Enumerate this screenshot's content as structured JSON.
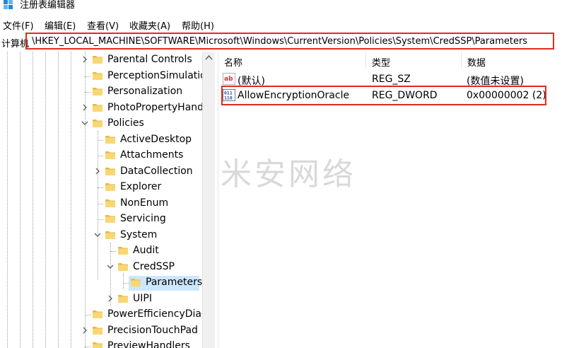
{
  "window": {
    "title": "注册表编辑器"
  },
  "menu": [
    {
      "label": "文件(F)"
    },
    {
      "label": "编辑(E)"
    },
    {
      "label": "查看(V)"
    },
    {
      "label": "收藏夹(A)"
    },
    {
      "label": "帮助(H)"
    }
  ],
  "address": {
    "prefix": "计算机",
    "path": "\\HKEY_LOCAL_MACHINE\\SOFTWARE\\Microsoft\\Windows\\CurrentVersion\\Policies\\System\\CredSSP\\Parameters"
  },
  "tree": {
    "nodes": [
      {
        "label": "Parental Controls",
        "expander": "collapsed"
      },
      {
        "label": "PerceptionSimulatio",
        "expander": "none"
      },
      {
        "label": "Personalization",
        "expander": "none"
      },
      {
        "label": "PhotoPropertyHand",
        "expander": "collapsed"
      },
      {
        "label": "Policies",
        "expander": "expanded"
      },
      {
        "label": "ActiveDesktop",
        "expander": "none"
      },
      {
        "label": "Attachments",
        "expander": "none"
      },
      {
        "label": "DataCollection",
        "expander": "collapsed"
      },
      {
        "label": "Explorer",
        "expander": "none"
      },
      {
        "label": "NonEnum",
        "expander": "none"
      },
      {
        "label": "Servicing",
        "expander": "none"
      },
      {
        "label": "System",
        "expander": "expanded"
      },
      {
        "label": "Audit",
        "expander": "none"
      },
      {
        "label": "CredSSP",
        "expander": "expanded"
      },
      {
        "label": "Parameters",
        "expander": "none",
        "selected": true
      },
      {
        "label": "UIPI",
        "expander": "collapsed"
      },
      {
        "label": "PowerEfficiencyDiag",
        "expander": "none"
      },
      {
        "label": "PrecisionTouchPad",
        "expander": "collapsed"
      },
      {
        "label": "PreviewHandlers",
        "expander": "none"
      }
    ]
  },
  "list": {
    "columns": [
      {
        "label": "名称"
      },
      {
        "label": "类型"
      },
      {
        "label": "数据"
      }
    ],
    "rows": [
      {
        "name": "(默认)",
        "type": "REG_SZ",
        "data": "(数值未设置)",
        "icon": "string-value-icon"
      },
      {
        "name": "AllowEncryptionOracle",
        "type": "REG_DWORD",
        "data": "0x00000002 (2)",
        "icon": "dword-value-icon"
      }
    ]
  },
  "watermark": "米安网络",
  "colors": {
    "highlight_border": "#e02b20",
    "selection": "#cce8ff",
    "folder": "#f8d775"
  }
}
